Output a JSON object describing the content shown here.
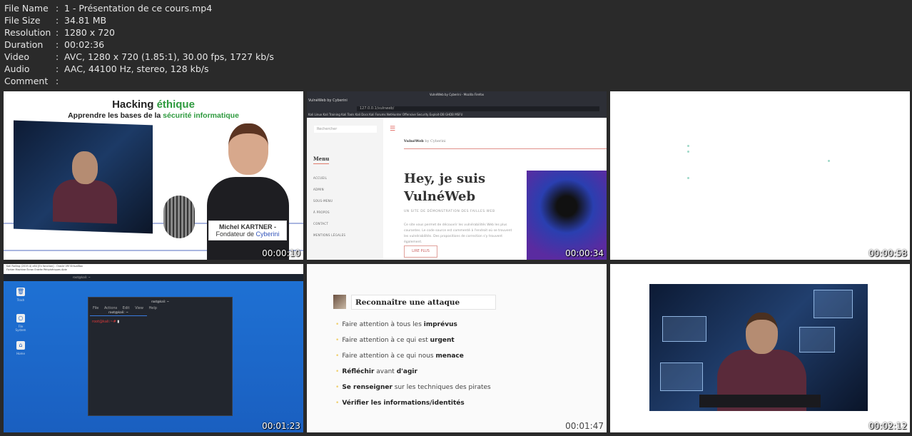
{
  "info": [
    {
      "key": "File Name",
      "value": "1 - Présentation de ce cours.mp4"
    },
    {
      "key": "File Size",
      "value": "34.81 MB"
    },
    {
      "key": "Resolution",
      "value": "1280 x 720"
    },
    {
      "key": "Duration",
      "value": "00:02:36"
    },
    {
      "key": "Video",
      "value": "AVC, 1280 x 720 (1.85:1), 30.00 fps, 1727 kb/s"
    },
    {
      "key": "Audio",
      "value": "AAC, 44100 Hz, stereo, 128 kb/s"
    },
    {
      "key": "Comment",
      "value": ""
    }
  ],
  "thumbs": [
    {
      "time": "00:00:10",
      "title_a": "Hacking ",
      "title_b": "éthique",
      "sub_a": "Apprendre les bases de la ",
      "sub_b": "sécurité informatique",
      "name": "Michel KARTNER -",
      "role_a": "Fondateur de ",
      "role_b": "Cyberini"
    },
    {
      "time": "00:00:34",
      "window_title": "VulnéWeb by Cyberini - Mozilla Firefox",
      "tab": "VulnéWeb by Cyberini",
      "url": "127.0.0.1/vulnweb/",
      "bookmarks": "Kali Linux   Kali Training   Kali Tools   Kali Docs   Kali Forums   NetHunter   Offensive Security   Exploit-DB   GHDB   MSFU",
      "search": "Rechercher",
      "menu": "Menu",
      "menu_items": [
        "ACCUEIL",
        "ADMIN",
        "SOUS-MENU",
        "À PROPOS",
        "CONTACT",
        "MENTIONS LÉGALES"
      ],
      "brand": "VulnéWeb",
      "brand_by": " by Cyberini",
      "hero1": "Hey, je suis",
      "hero2": "VulnéWeb",
      "subtitle": "UN SITE DE DÉMONSTRATION DES FAILLES WEB",
      "paragraph": "Ce site vous permet de découvrir les vulnérabilités Web les plus courantes. Le code source est commenté à l'endroit où se trouvent les vulnérabilités. Des propositions de correction s'y trouvent également.",
      "button": "LIRE PLUS"
    },
    {
      "time": "00:00:58"
    },
    {
      "time": "00:01:23",
      "vb_title": "Kali Rolling (2019.4) x64 [En fonction] - Oracle VM VirtualBox",
      "vb_menu": "Fichier  Machine  Écran  Entrée  Périphériques  Aide",
      "panel_task": "root@kali: ~",
      "icons": [
        "Trash",
        "File System",
        "Home"
      ],
      "term_title": "root@kali: ~",
      "term_menu": "File Actions Edit View Help",
      "term_tab": "root@kali: ~",
      "prompt": "root@kali:~#"
    },
    {
      "time": "00:01:47",
      "title": "Reconnaître une attaque",
      "items": [
        [
          {
            "t": "Faire attention à tous les ",
            "b": false
          },
          {
            "t": "imprévus",
            "b": true
          }
        ],
        [
          {
            "t": "Faire attention à ce qui est ",
            "b": false
          },
          {
            "t": "urgent",
            "b": true
          }
        ],
        [
          {
            "t": "Faire attention à ce qui nous ",
            "b": false
          },
          {
            "t": "menace",
            "b": true
          }
        ],
        [
          {
            "t": "Réfléchir",
            "b": true
          },
          {
            "t": " avant ",
            "b": false
          },
          {
            "t": "d'agir",
            "b": true
          }
        ],
        [
          {
            "t": "Se renseigner",
            "b": true
          },
          {
            "t": " sur les techniques des pirates",
            "b": false
          }
        ],
        [
          {
            "t": "Vérifier les informations/identités",
            "b": true
          }
        ]
      ]
    },
    {
      "time": "00:02:12"
    }
  ]
}
